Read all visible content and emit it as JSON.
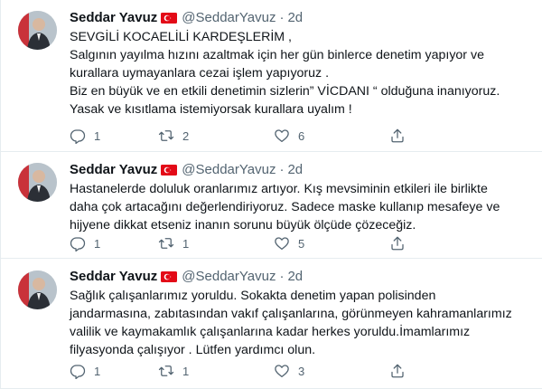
{
  "tweets": [
    {
      "author": {
        "name": "Seddar Yavuz",
        "handle": "@SeddarYavuz",
        "flag": "turkey-flag-icon"
      },
      "separator": "·",
      "time": "2d",
      "lines": [
        "SEVGİLİ KOCAELİLİ KARDEŞLERİM ,",
        "Salgının yayılma hızını azaltmak için her gün binlerce denetim yapıyor ve",
        "kurallara uymayanlara cezai işlem yapıyoruz .",
        "Biz en büyük ve en etkili denetimin sizlerin” VİCDANI “ olduğuna inanıyoruz.",
        "Yasak ve kısıtlama istemiyorsak kurallara uyalım !"
      ],
      "replies": "1",
      "retweets": "2",
      "likes": "6"
    },
    {
      "author": {
        "name": "Seddar Yavuz",
        "handle": "@SeddarYavuz",
        "flag": "turkey-flag-icon"
      },
      "separator": "·",
      "time": "2d",
      "lines": [
        "Hastanelerde doluluk oranlarımız artıyor. Kış mevsiminin etkileri ile birlikte",
        "daha çok artacağını değerlendiriyoruz. Sadece maske kullanıp mesafeye ve",
        "hijyene dikkat etseniz inanın sorunu büyük ölçüde çözeceğiz."
      ],
      "replies": "1",
      "retweets": "1",
      "likes": "5"
    },
    {
      "author": {
        "name": "Seddar Yavuz",
        "handle": "@SeddarYavuz",
        "flag": "turkey-flag-icon"
      },
      "separator": "·",
      "time": "2d",
      "lines": [
        "Sağlık çalışanlarımız yoruldu. Sokakta denetim yapan polisinden",
        "jandarmasına, zabıtasından vakıf çalışanlarına, görünmeyen kahramanlarımız",
        "valilik ve kaymakamlık çalışanlarına kadar herkes yoruldu.İmamlarımız",
        "filyasyonda çalışıyor . Lütfen yardımcı olun."
      ],
      "replies": "1",
      "retweets": "1",
      "likes": "3"
    }
  ],
  "colors": {
    "text": "#0f1419",
    "secondary": "#536471",
    "flag_red": "#e30a17",
    "divider": "#e6ecf0"
  }
}
